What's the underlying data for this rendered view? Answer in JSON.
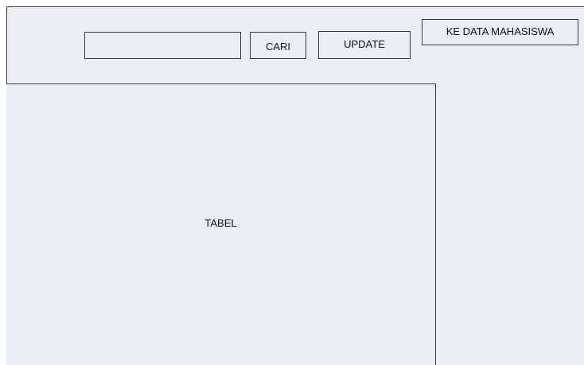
{
  "toolbar": {
    "search_value": "",
    "cari_label": "CARI",
    "update_label": "UPDATE",
    "nav_label": "KE DATA MAHASISWA"
  },
  "main": {
    "table_label": "TABEL"
  },
  "colors": {
    "background": "#e8edf7",
    "border": "#3a3a3a"
  }
}
